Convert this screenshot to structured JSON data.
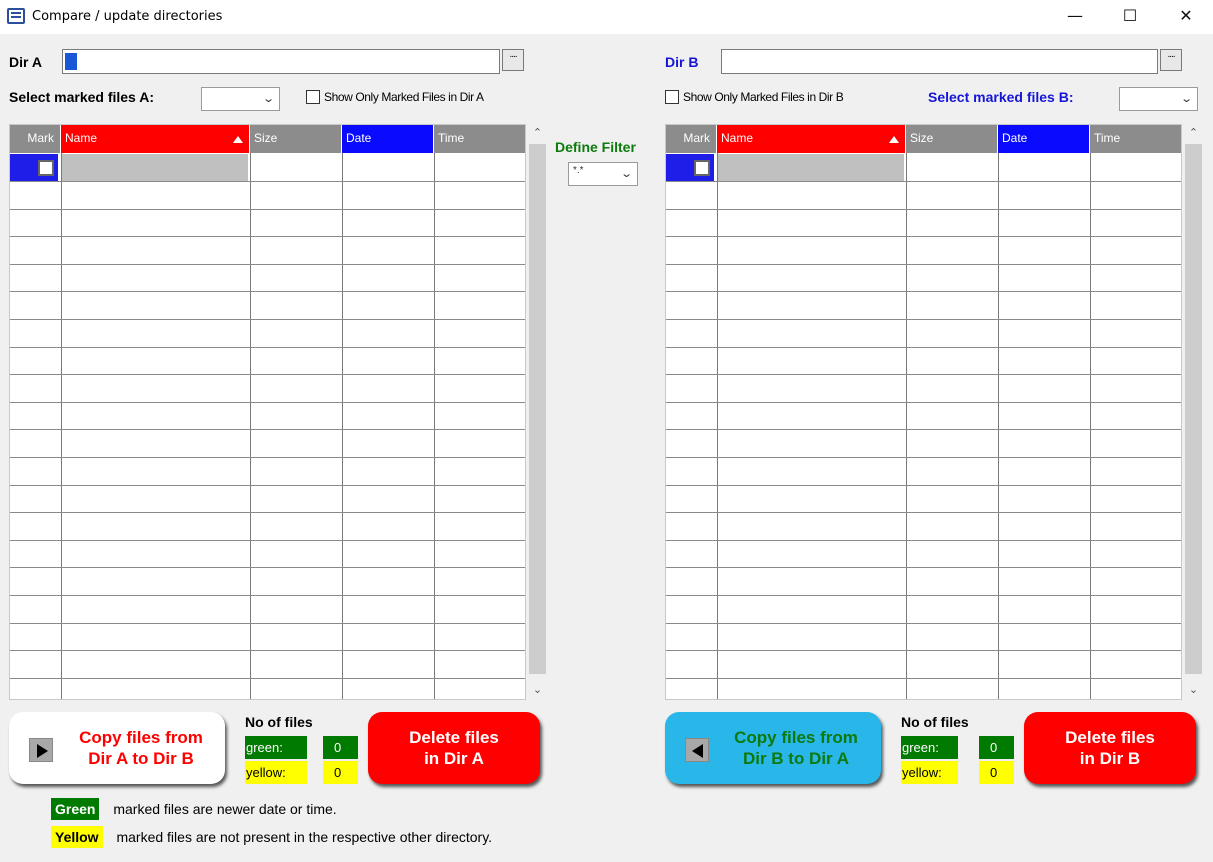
{
  "window": {
    "title": "Compare / update directories",
    "controls": [
      "minimize",
      "maximize",
      "close"
    ]
  },
  "dir_a": {
    "label": "Dir A",
    "value": "",
    "browse_label": "....",
    "select_label": "Select marked files A:",
    "select_value": "",
    "show_only_label": "Show Only Marked Files in Dir A",
    "show_only_checked": false
  },
  "dir_b": {
    "label": "Dir B",
    "value": "",
    "browse_label": "....",
    "select_label": "Select marked files B:",
    "select_value": "",
    "show_only_label": "Show Only Marked Files in Dir B",
    "show_only_checked": false
  },
  "filter": {
    "label": "Define Filter",
    "value": "*.*"
  },
  "grid_columns": [
    "Mark",
    "Name",
    "Size",
    "Date",
    "Time"
  ],
  "grid_a": {
    "rows": []
  },
  "grid_b": {
    "rows": []
  },
  "actions": {
    "copy_a_to_b_line1": "Copy files from",
    "copy_a_to_b_line2": "Dir A to Dir B",
    "copy_b_to_a_line1": "Copy files from",
    "copy_b_to_a_line2": "Dir B to Dir A",
    "delete_a_line1": "Delete files",
    "delete_a_line2": "in Dir A",
    "delete_b_line1": "Delete files",
    "delete_b_line2": "in Dir B"
  },
  "counts_a": {
    "title": "No of files",
    "green_label": "green:",
    "green_value": "0",
    "yellow_label": "yellow:",
    "yellow_value": "0"
  },
  "counts_b": {
    "title": "No of files",
    "green_label": "green:",
    "green_value": "0",
    "yellow_label": "yellow:",
    "yellow_value": "0"
  },
  "legend": {
    "green_tag": "Green",
    "green_text": "marked files are newer date or time.",
    "yellow_tag": "Yellow",
    "yellow_text": "marked files are not present in the respective other directory."
  },
  "colors": {
    "header_name": "#ff0000",
    "header_date": "#0a0aff",
    "delete_button": "#ff0000",
    "copy_b_button": "#29b6e8",
    "green": "#007a00",
    "yellow": "#ffff00"
  }
}
